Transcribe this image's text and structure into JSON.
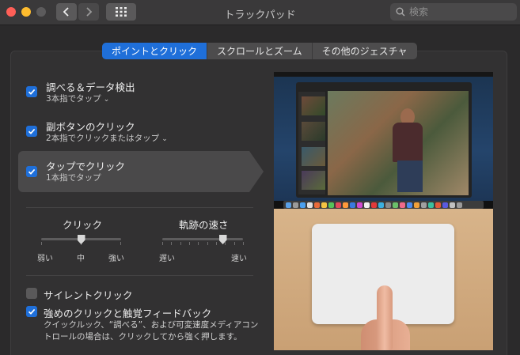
{
  "window": {
    "title": "トラックパッド",
    "search_placeholder": "検索"
  },
  "tabs": [
    {
      "label": "ポイントとクリック",
      "active": true
    },
    {
      "label": "スクロールとズーム",
      "active": false
    },
    {
      "label": "その他のジェスチャ",
      "active": false
    }
  ],
  "options": [
    {
      "title": "調べる＆データ検出",
      "subtitle": "3本指でタップ",
      "checked": true,
      "has_menu": true
    },
    {
      "title": "副ボタンのクリック",
      "subtitle": "2本指でクリックまたはタップ",
      "checked": true,
      "has_menu": true
    },
    {
      "title": "タップでクリック",
      "subtitle": "1本指でタップ",
      "checked": true,
      "selected": true
    }
  ],
  "sliders": {
    "click": {
      "title": "クリック",
      "min_label": "弱い",
      "mid_label": "中",
      "max_label": "強い",
      "value": 0.5
    },
    "tracking": {
      "title": "軌跡の速さ",
      "min_label": "遅い",
      "max_label": "速い",
      "value": 0.75
    }
  },
  "bottom_options": [
    {
      "title": "サイレントクリック",
      "checked": false
    },
    {
      "title": "強めのクリックと触覚フィードバック",
      "checked": true
    }
  ],
  "force_click_description": "クイックルック、“調べる”、および可変速度メディアコントロールの場合は、クリックしてから強く押します。",
  "icons": [
    "back-icon",
    "forward-icon",
    "grid-icon",
    "search-icon",
    "checkmark-icon",
    "chevron-down-icon"
  ],
  "colors": {
    "accent": "#1f6fd9",
    "window_bg": "#2b2a2b"
  }
}
